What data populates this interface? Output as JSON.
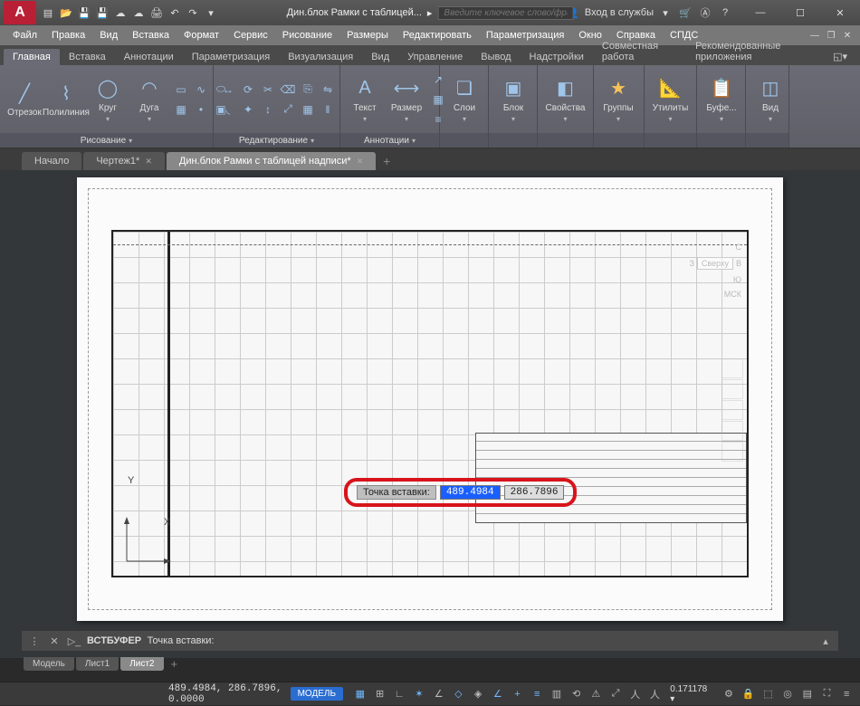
{
  "titlebar": {
    "app_letter": "A",
    "doc_title": "Дин.блок Рамки с таблицей...",
    "search_ph": "Введите ключевое слово/фразу",
    "login": "Вход в службы"
  },
  "menubar": [
    "Файл",
    "Правка",
    "Вид",
    "Вставка",
    "Формат",
    "Сервис",
    "Рисование",
    "Размеры",
    "Редактировать",
    "Параметризация",
    "Окно",
    "Справка",
    "СПДС"
  ],
  "ribbon_tabs": [
    "Главная",
    "Вставка",
    "Аннотации",
    "Параметризация",
    "Визуализация",
    "Вид",
    "Управление",
    "Вывод",
    "Надстройки",
    "Совместная работа",
    "Рекомендованные приложения"
  ],
  "ribbon_active": 0,
  "panels": {
    "draw": {
      "title": "Рисование",
      "otrezok": "Отрезок",
      "poly": "Полилиния",
      "krug": "Круг",
      "duga": "Дуга"
    },
    "edit": {
      "title": "Редактирование"
    },
    "annot": {
      "title": "Аннотации",
      "text": "Текст",
      "razmer": "Размер"
    },
    "sloi": "Слои",
    "blok": "Блок",
    "svoistva": "Свойства",
    "gruppy": "Группы",
    "utility": "Утилиты",
    "bufer": "Буфе...",
    "vid": "Вид"
  },
  "doc_tabs": [
    {
      "label": "Начало",
      "active": false,
      "dirty": false
    },
    {
      "label": "Чертеж1*",
      "active": false,
      "dirty": true
    },
    {
      "label": "Дин.блок Рамки с таблицей надписи*",
      "active": true,
      "dirty": true
    }
  ],
  "view_cube": {
    "sverhu": "Сверху",
    "msk": "МСК",
    "s": "С",
    "z": "З",
    "v": "В",
    "yu": "Ю"
  },
  "dyn_input": {
    "label": "Точка вставки:",
    "x": "489.4984",
    "y": "286.7896"
  },
  "cmd": {
    "cmd_name": "ВСТБУФЕР",
    "prompt": "Точка вставки:"
  },
  "layout_tabs": [
    {
      "label": "Модель",
      "active": false
    },
    {
      "label": "Лист1",
      "active": false
    },
    {
      "label": "Лист2",
      "active": true
    }
  ],
  "status": {
    "coords": "489.4984, 286.7896, 0.0000",
    "model": "МОДЕЛЬ",
    "scale": "0.171178"
  }
}
